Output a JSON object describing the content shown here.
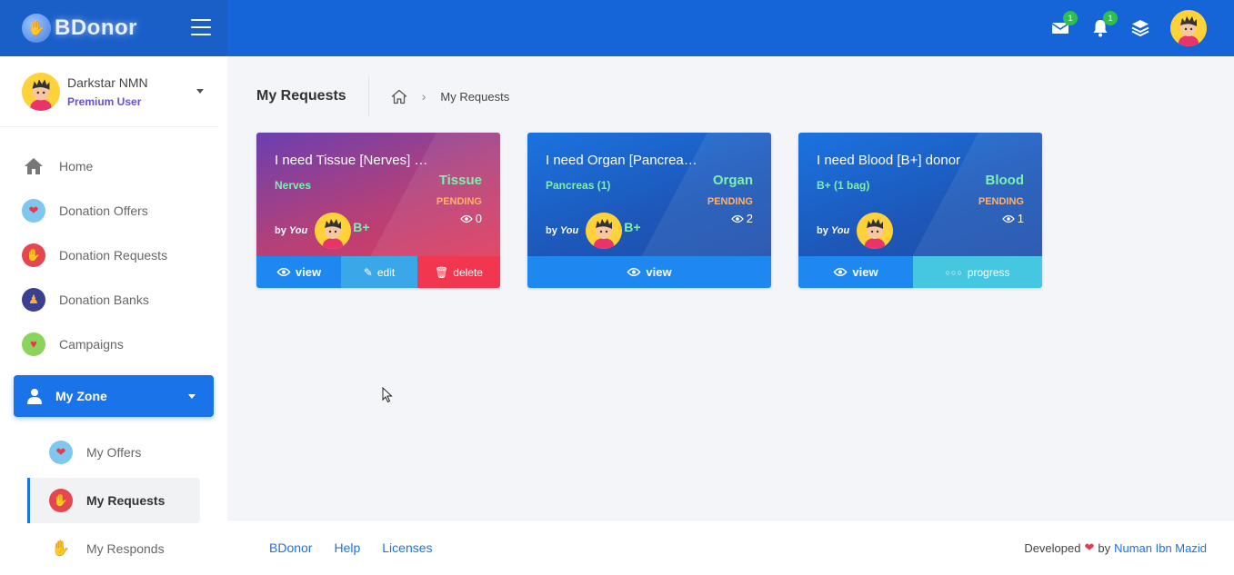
{
  "brand": {
    "name": "BDonor",
    "logo_icon": "hands-logo-icon"
  },
  "topbar": {
    "mail_badge": "1",
    "notification_badge": "1",
    "icons": [
      "mail-icon",
      "bell-icon",
      "layers-icon",
      "avatar"
    ]
  },
  "user": {
    "name": "Darkstar NMN",
    "role": "Premium User"
  },
  "sidebar": {
    "items": [
      {
        "label": "Home",
        "icon": "home-icon"
      },
      {
        "label": "Donation Offers",
        "icon": "heart-offer-icon"
      },
      {
        "label": "Donation Requests",
        "icon": "hand-request-icon"
      },
      {
        "label": "Donation Banks",
        "icon": "bank-icon"
      },
      {
        "label": "Campaigns",
        "icon": "campaign-icon"
      }
    ],
    "zone": {
      "label": "My Zone",
      "icon": "user-icon"
    },
    "zone_items": [
      {
        "label": "My Offers",
        "icon": "heart-offer-icon"
      },
      {
        "label": "My Requests",
        "icon": "hand-request-icon",
        "active": true
      },
      {
        "label": "My Responds",
        "icon": "raised-hand-icon"
      }
    ]
  },
  "page": {
    "title": "My Requests",
    "breadcrumb": [
      "My Requests"
    ]
  },
  "cards": [
    {
      "title": "I need Tissue [Nerves] d...",
      "subtitle": "Nerves",
      "type": "Tissue",
      "status": "PENDING",
      "views": "0",
      "by_prefix": "by",
      "by_name": "You",
      "blood": "B+",
      "actions": [
        "view",
        "edit",
        "delete"
      ]
    },
    {
      "title": "I need Organ [Pancreas] ...",
      "subtitle": "Pancreas (1)",
      "type": "Organ",
      "status": "PENDING",
      "views": "2",
      "by_prefix": "by",
      "by_name": "You",
      "blood": "B+",
      "actions": [
        "view"
      ]
    },
    {
      "title": "I need Blood [B+] donor",
      "subtitle": "B+ (1 bag)",
      "type": "Blood",
      "status": "PENDING",
      "views": "1",
      "by_prefix": "by",
      "by_name": "You",
      "blood": "",
      "actions": [
        "view",
        "progress"
      ]
    }
  ],
  "footer": {
    "links": [
      "BDonor",
      "Help",
      "Licenses"
    ],
    "credit_prefix": "Developed",
    "credit_by": "by",
    "credit_author": "Numan Ibn Mazid"
  },
  "colors": {
    "topbar": "#1565d8",
    "accent": "#1a73e8",
    "pending": "#ffb26b",
    "type_label": "#7df0b0",
    "delete": "#f2364f"
  }
}
